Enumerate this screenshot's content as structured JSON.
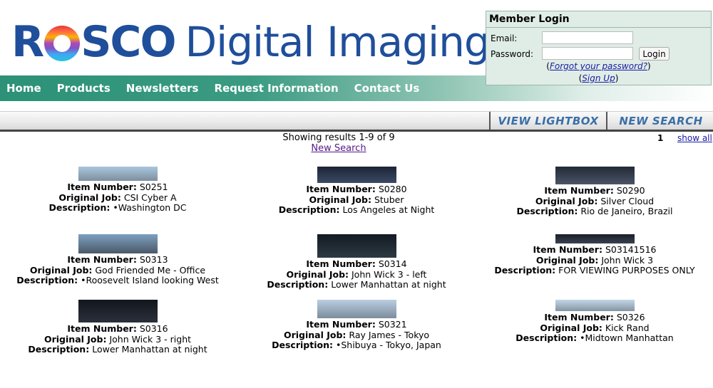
{
  "logo": {
    "r": "R",
    "sco": "SCO",
    "digital": "Digital Imaging"
  },
  "nav": [
    "Home",
    "Products",
    "Newsletters",
    "Request Information",
    "Contact Us"
  ],
  "login": {
    "title": "Member Login",
    "email_label": "Email:",
    "password_label": "Password:",
    "button": "Login",
    "forgot_pre": "(",
    "forgot": "Forgot your password?",
    "forgot_post": ")",
    "signup_pre": "(",
    "signup": "Sign Up",
    "signup_post": ")"
  },
  "toolbar": {
    "lightbox": "VIEW LIGHTBOX",
    "new_search": "NEW SEARCH"
  },
  "results": {
    "showing": "Showing results 1-9 of 9",
    "new_search": "New Search",
    "page": "1",
    "show_all": "show all"
  },
  "labels": {
    "item": "Item Number:",
    "job": "Original Job:",
    "desc": "Description:"
  },
  "items": [
    {
      "number": "S0251",
      "job": "CSI Cyber A",
      "desc": "•Washington DC",
      "colors": [
        "#a9c6de",
        "#7e8f9d"
      ]
    },
    {
      "number": "S0280",
      "job": "Stuber",
      "desc": "Los Angeles at Night",
      "colors": [
        "#1c2436",
        "#3c4a64"
      ]
    },
    {
      "number": "S0290",
      "job": "Silver Cloud",
      "desc": "Rio de Janeiro, Brazil",
      "colors": [
        "#222a36",
        "#4a5466"
      ]
    },
    {
      "number": "S0313",
      "job": "God Friended Me - Office",
      "desc": "•Roosevelt Island looking West",
      "colors": [
        "#7d9fc0",
        "#4b5968"
      ]
    },
    {
      "number": "S0314",
      "job": "John Wick 3 - left",
      "desc": "Lower Manhattan at night",
      "colors": [
        "#131a22",
        "#2d3a44"
      ]
    },
    {
      "number": "S03141516",
      "job": "John Wick 3",
      "desc": "FOR VIEWING PURPOSES ONLY",
      "colors": [
        "#1a1f28",
        "#3a4250"
      ]
    },
    {
      "number": "S0316",
      "job": "John Wick 3 - right",
      "desc": "Lower Manhattan at night",
      "colors": [
        "#12161e",
        "#2a303a"
      ]
    },
    {
      "number": "S0321",
      "job": "Ray James - Tokyo",
      "desc": "•Shibuya - Tokyo, Japan",
      "colors": [
        "#b9cee0",
        "#7c8c9c"
      ]
    },
    {
      "number": "S0326",
      "job": "Kick Rand",
      "desc": "•Midtown Manhattan",
      "colors": [
        "#c3d6e6",
        "#8594a3"
      ]
    }
  ]
}
